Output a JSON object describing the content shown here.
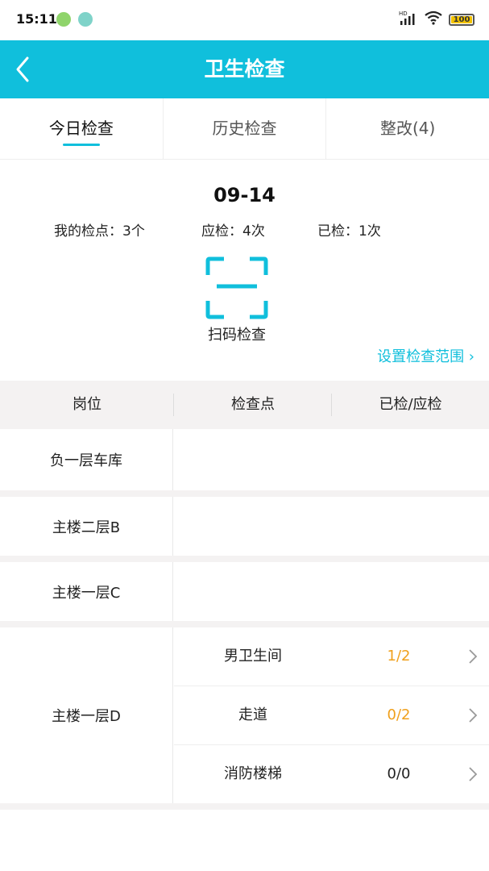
{
  "status_bar": {
    "time": "15:11",
    "network": "HD",
    "battery": "100",
    "icons": [
      "app-notification-icon",
      "app-notification-icon",
      "signal-icon",
      "wifi-icon",
      "battery-icon"
    ]
  },
  "header": {
    "title": "卫生检查",
    "back_icon": "chevron-left-icon"
  },
  "tabs": [
    {
      "label": "今日检查",
      "active": true
    },
    {
      "label": "历史检查",
      "active": false
    },
    {
      "label": "整改(4)",
      "active": false
    }
  ],
  "summary": {
    "date": "09-14",
    "my_points": "我的检点：3个",
    "should_check": "应检：4次",
    "checked": "已检：1次",
    "scan_label": "扫码检查",
    "scope_link": "设置检查范围 ›"
  },
  "table": {
    "headers": [
      "岗位",
      "检查点",
      "已检/应检"
    ],
    "rows": [
      {
        "position": "负一层车库",
        "points": []
      },
      {
        "position": "主楼二层B",
        "points": []
      },
      {
        "position": "主楼一层C",
        "points": []
      },
      {
        "position": "主楼一层D",
        "points": [
          {
            "name": "男卫生间",
            "count": "1/2"
          },
          {
            "name": "走道",
            "count": "0/2"
          },
          {
            "name": "消防楼梯",
            "count": "0/0"
          }
        ]
      }
    ]
  },
  "colors": {
    "accent": "#10bfdc",
    "pending": "#f0a01c",
    "done": "#222222",
    "divider_bg": "#f4f2f2"
  }
}
